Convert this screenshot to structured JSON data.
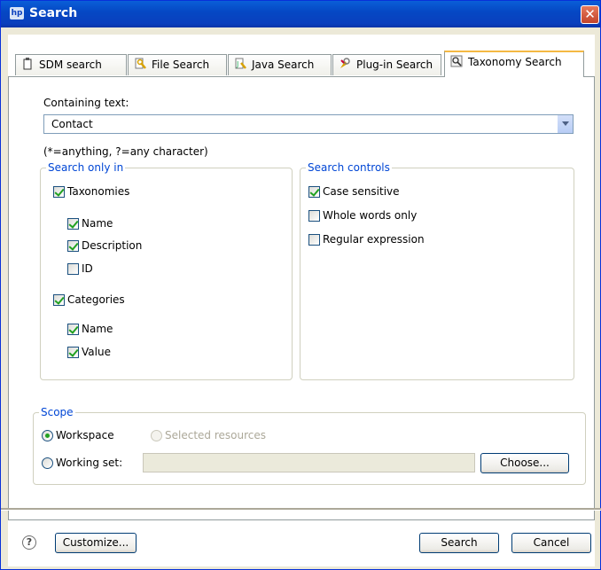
{
  "window": {
    "title": "Search"
  },
  "tabs": [
    {
      "label": "SDM search",
      "icon": "sdm-search-icon"
    },
    {
      "label": "File Search",
      "icon": "file-search-icon"
    },
    {
      "label": "Java Search",
      "icon": "java-search-icon"
    },
    {
      "label": "Plug-in Search",
      "icon": "plugin-search-icon"
    },
    {
      "label": "Taxonomy Search",
      "icon": "taxonomy-search-icon",
      "active": true
    }
  ],
  "containing_text": {
    "label": "Containing text:",
    "value": "Contact",
    "hint": "(*=anything, ?=any character)"
  },
  "search_only_in": {
    "title": "Search only in",
    "taxonomies": {
      "label": "Taxonomies",
      "checked": true
    },
    "tax_name": {
      "label": "Name",
      "checked": true
    },
    "tax_description": {
      "label": "Description",
      "checked": true
    },
    "tax_id": {
      "label": "ID",
      "checked": false
    },
    "categories": {
      "label": "Categories",
      "checked": true
    },
    "cat_name": {
      "label": "Name",
      "checked": true
    },
    "cat_value": {
      "label": "Value",
      "checked": true
    }
  },
  "search_controls": {
    "title": "Search controls",
    "case_sensitive": {
      "label": "Case sensitive",
      "checked": true
    },
    "whole_words": {
      "label": "Whole words only",
      "checked": false
    },
    "regex": {
      "label": "Regular expression",
      "checked": false
    }
  },
  "scope": {
    "title": "Scope",
    "workspace": "Workspace",
    "selected_resources": "Selected resources",
    "working_set": "Working set:",
    "working_set_value": "",
    "choose": "Choose..."
  },
  "footer": {
    "customize": "Customize...",
    "search": "Search",
    "cancel": "Cancel"
  },
  "colors": {
    "title_bar": "#0a5fd8",
    "group_title": "#0046d5",
    "dialog_bg": "#ece9d8",
    "active_tab_highlight": "#f4b943"
  }
}
